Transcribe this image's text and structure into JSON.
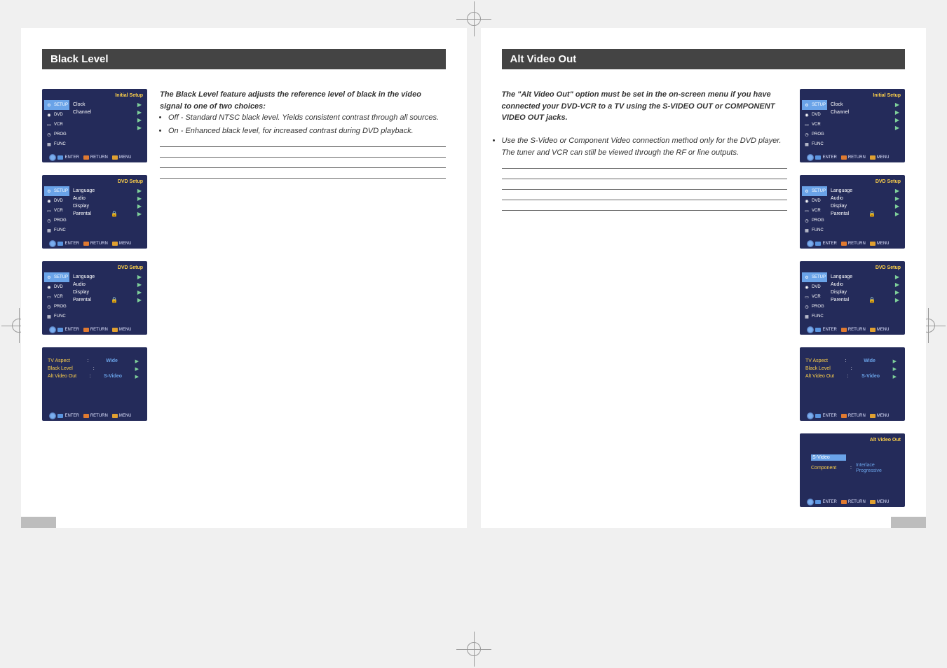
{
  "left": {
    "section_title": "Black Level",
    "intro": "The Black Level feature adjusts the reference level of black in the video signal to one of two choices:",
    "bullets": [
      "Off -   Standard NTSC black level. Yields consistent contrast through all sources.",
      "On -   Enhanced black level, for increased contrast during DVD playback."
    ],
    "osd": {
      "initial_setup_title": "Initial Setup",
      "dvd_setup_title": "DVD Setup",
      "sidebar": [
        "SETUP",
        "DVD",
        "VCR",
        "PROG",
        "FUNC"
      ],
      "initial_items": [
        "Clock",
        "Channel"
      ],
      "dvd_items": [
        "Language",
        "Audio",
        "Display",
        "Parental"
      ],
      "display_menu": {
        "rows": [
          {
            "label": "TV Aspect",
            "value": "Wide"
          },
          {
            "label": "Black Level",
            "value": " "
          },
          {
            "label": "Alt Video Out",
            "value": "S-Video"
          }
        ]
      },
      "footer": {
        "enter": "ENTER",
        "ret": "RETURN",
        "menu": "MENU"
      }
    }
  },
  "right": {
    "section_title": "Alt Video Out",
    "para1": "The \"Alt Video Out\" option must be set in the on-screen menu if you have connected your DVD-VCR to a TV using the S-VIDEO OUT or COMPONENT VIDEO OUT jacks.",
    "bullet1": "Use the S-Video or Component Video connection method only for the DVD player. The tuner and VCR can still be viewed through the RF or line outputs.",
    "osd": {
      "initial_setup_title": "Initial Setup",
      "dvd_setup_title": "DVD Setup",
      "alt_video_out_title": "Alt Video Out",
      "sidebar": [
        "SETUP",
        "DVD",
        "VCR",
        "PROG",
        "FUNC"
      ],
      "initial_items": [
        "Clock",
        "Channel"
      ],
      "dvd_items": [
        "Language",
        "Audio",
        "Display",
        "Parental"
      ],
      "display_menu": {
        "rows": [
          {
            "label": "TV Aspect",
            "value": "Wide"
          },
          {
            "label": "Black Level",
            "value": " "
          },
          {
            "label": "Alt Video Out",
            "value": "S-Video"
          }
        ]
      },
      "altout_menu": {
        "svideo": "S-Video",
        "component": "Component",
        "interlace": "Interlace",
        "progressive": "Progressive"
      },
      "footer": {
        "enter": "ENTER",
        "ret": "RETURN",
        "menu": "MENU"
      }
    }
  }
}
